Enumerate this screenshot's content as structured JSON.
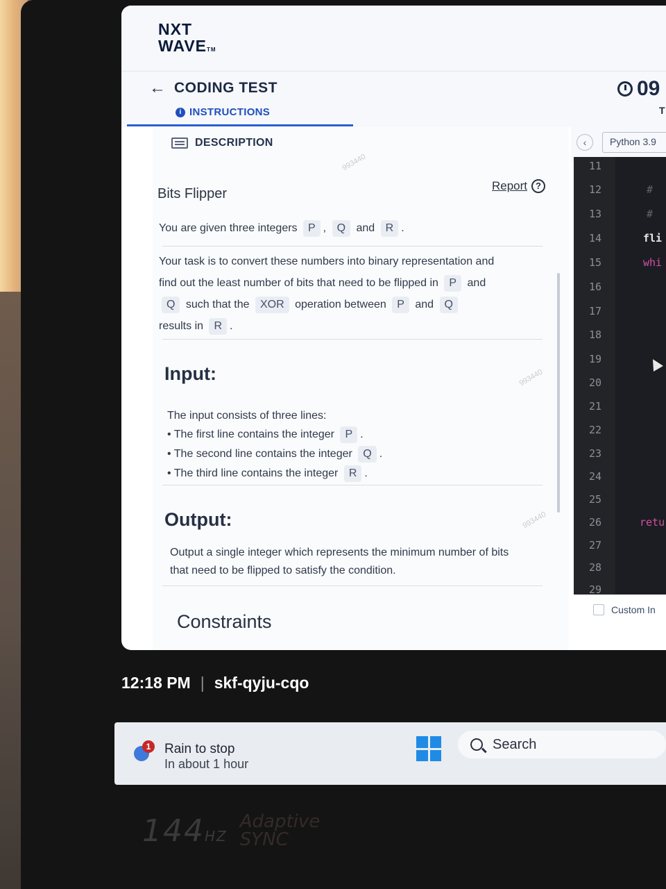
{
  "app": {
    "logo_line1": "NXT",
    "logo_line2": "WAVE",
    "logo_tm": "TM"
  },
  "header": {
    "back_label": "←",
    "title": "CODING TEST",
    "instructions_tab": "INSTRUCTIONS",
    "timer": "09",
    "timer_sub": "T"
  },
  "problem": {
    "tab_label": "DESCRIPTION",
    "title": "Bits Flipper",
    "report_label": "Report",
    "intro_prefix": "You are given three integers",
    "intro_p": "P",
    "intro_sep": ",",
    "intro_q": "Q",
    "intro_and": "and",
    "intro_r": "R",
    "intro_end": ".",
    "task_line1": "Your task is to convert these numbers into binary representation and",
    "task_line2_a": "find out the least number of bits that need to be flipped in",
    "task_p": "P",
    "task_and1": "and",
    "task_q": "Q",
    "task_line3_a": "such that the",
    "task_xor": "XOR",
    "task_line3_b": "operation between",
    "task_p2": "P",
    "task_and2": "and",
    "task_q2": "Q",
    "task_line4_a": "results in",
    "task_r": "R",
    "task_end": ".",
    "input_heading": "Input:",
    "input_intro": "The input consists of three lines:",
    "input_bullets": [
      {
        "text": "The first line contains the integer",
        "var": "P",
        "end": "."
      },
      {
        "text": "The second line contains the integer",
        "var": "Q",
        "end": "."
      },
      {
        "text": "The third line contains the integer",
        "var": "R",
        "end": "."
      }
    ],
    "output_heading": "Output:",
    "output_line1": "Output a single integer which represents the minimum number of bits",
    "output_line2": "that need to be flipped to satisfy the condition.",
    "constraints_heading": "Constraints",
    "watermark": "993440"
  },
  "editor": {
    "language": "Python 3.9",
    "line_numbers": [
      "11",
      "12",
      "13",
      "14",
      "15",
      "16",
      "17",
      "18",
      "19",
      "20",
      "21",
      "22",
      "23",
      "24",
      "25",
      "26",
      "27",
      "28",
      "29"
    ],
    "code_fragments": {
      "line12": "#",
      "line13": "#",
      "line14": "fli",
      "line15": "whi",
      "line26": "retu"
    },
    "custom_input_label": "Custom In"
  },
  "meeting": {
    "time": "12:18 PM",
    "separator": "|",
    "code": "skf-qyju-cqo"
  },
  "taskbar": {
    "weather_badge": "1",
    "weather_line1": "Rain to stop",
    "weather_line2": "In about 1 hour",
    "search_label": "Search"
  },
  "bezel": {
    "refresh": "144",
    "refresh_unit": "HZ",
    "adaptive_line1": "Adaptive",
    "adaptive_line2": "SYNC"
  }
}
